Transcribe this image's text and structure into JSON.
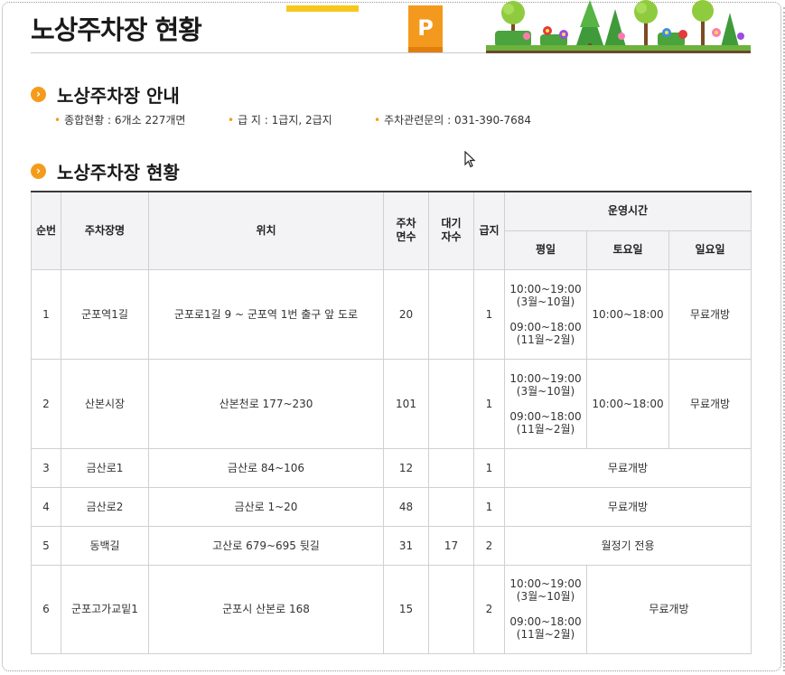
{
  "page": {
    "title": "노상주차장 현황",
    "parking_sign": "P"
  },
  "guide": {
    "title": "노상주차장 안내",
    "items": [
      "종합현황 : 6개소 227개면",
      "급 지 : 1급지, 2급지",
      "주차관련문의 : 031-390-7684"
    ]
  },
  "status": {
    "title": "노상주차장 현황"
  },
  "table": {
    "headers": {
      "no": "순번",
      "name": "주차장명",
      "location": "위치",
      "spaces_line1": "주차",
      "spaces_line2": "면수",
      "waiting_line1": "대기",
      "waiting_line2": "자수",
      "grade": "급지",
      "hours": "운영시간",
      "weekday": "평일",
      "saturday": "토요일",
      "sunday": "일요일"
    },
    "rows": [
      {
        "no": "1",
        "name": "군포역1길",
        "location": "군포로1길 9 ~ 군포역 1번 출구 앞 도로",
        "spaces": "20",
        "waiting": "",
        "grade": "1",
        "weekday": "10:00~19:00\n(3월~10월)\n\n09:00~18:00\n(11월~2월)",
        "saturday": "10:00~18:00",
        "sunday": "무료개방"
      },
      {
        "no": "2",
        "name": "산본시장",
        "location": "산본천로 177~230",
        "spaces": "101",
        "waiting": "",
        "grade": "1",
        "weekday": "10:00~19:00\n(3월~10월)\n\n09:00~18:00\n(11월~2월)",
        "saturday": "10:00~18:00",
        "sunday": "무료개방"
      },
      {
        "no": "3",
        "name": "금산로1",
        "location": "금산로 84~106",
        "spaces": "12",
        "waiting": "",
        "grade": "1",
        "hours": "무료개방"
      },
      {
        "no": "4",
        "name": "금산로2",
        "location": "금산로 1~20",
        "spaces": "48",
        "waiting": "",
        "grade": "1",
        "hours": "무료개방"
      },
      {
        "no": "5",
        "name": "동백길",
        "location": "고산로 679~695 뒷길",
        "spaces": "31",
        "waiting": "17",
        "grade": "2",
        "hours": "월정기 전용"
      },
      {
        "no": "6",
        "name": "군포고가교밑1",
        "location": "군포시 산본로 168",
        "spaces": "15",
        "waiting": "",
        "grade": "2",
        "weekday": "10:00~19:00\n(3월~10월)\n\n09:00~18:00\n(11월~2월)",
        "weekend": "무료개방"
      }
    ]
  },
  "colors": {
    "accent": "#f59b1b",
    "header_bg": "#f3f3f5",
    "border": "#d0d0d0",
    "title_line": "#3a3a3a"
  },
  "icons": [
    "parking-sign-icon",
    "chevron-circle-icon",
    "mouse-cursor-icon",
    "trees-flowers-decoration"
  ]
}
